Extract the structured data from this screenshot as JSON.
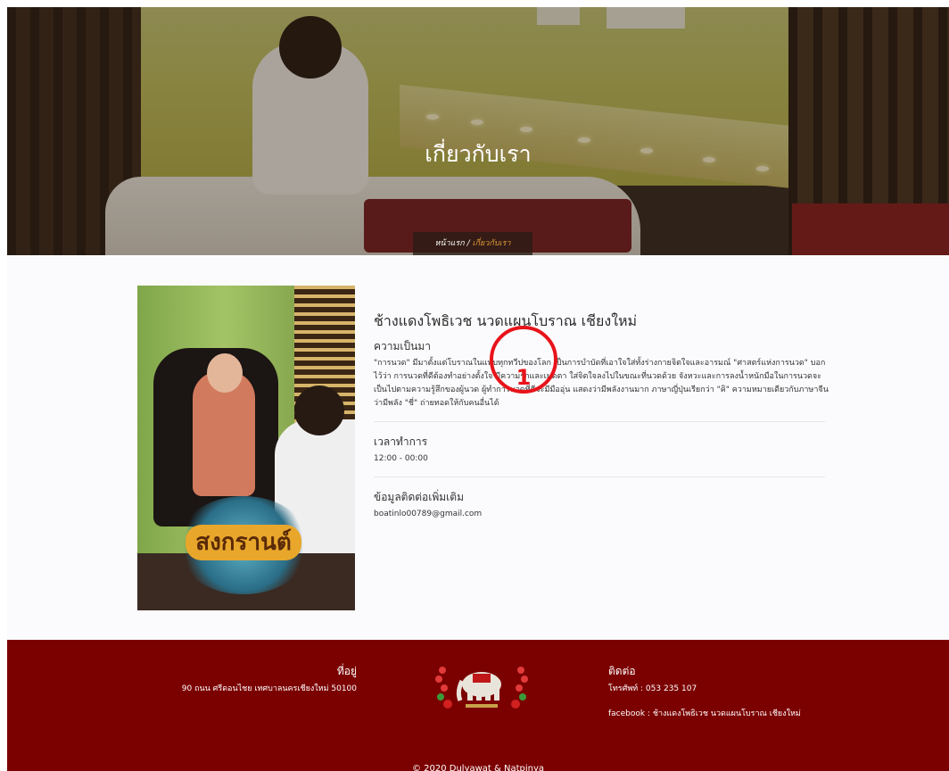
{
  "hero": {
    "title": "เกี่ยวกับเรา",
    "breadcrumb": {
      "home": "หน้าแรก",
      "separator": "/",
      "current": "เกี่ยวกับเรา"
    }
  },
  "about": {
    "shop_name": "ช้างแดงโพธิเวช นวดแผนโบราณ เชียงใหม่",
    "history": {
      "heading": "ความเป็นมา",
      "text": "\"การนวด\" มีมาตั้งแต่โบราณในแทบทุกทวีปของโลก เป็นการบำบัดที่เอาใจใส่ทั้งร่างกายจิตใจและอารมณ์ \"ศาสตร์แห่งการนวด\" บอกไว้ว่า การนวดที่ดีต้องทำอย่างตั้งใจ มีความรักและเมตตา ใส่จิตใจลงไปในขณะที่นวดด้วย จังหวะและการลงน้ำหนักมือในการนวดจะเป็นไปตามความรู้สึกของผู้นวด ผู้ทำการนวดที่ดีจะมีมืออุ่น แสดงว่ามีพลังงานมาก ภาษาญี่ปุ่นเรียกว่า \"คิ\" ความหมายเดียวกับภาษาจีนว่ามีพลัง \"ชี่\" ถ่ายทอดให้กับคนอื่นได้"
    },
    "hours": {
      "heading": "เวลาทำการ",
      "value": "12:00 - 00:00"
    },
    "contact": {
      "heading": "ข้อมูลติดต่อเพิ่มเติม",
      "email": "boatinlo00789@gmail.com"
    },
    "photo_badge": "สงกรานต์"
  },
  "annotation": {
    "number": "1",
    "color": "#e8131a"
  },
  "footer": {
    "address": {
      "heading": "ที่อยู่",
      "text": "90 ถนน ศรีดอนไชย เทศบาลนครเชียงใหม่ 50100"
    },
    "contact": {
      "heading": "ติดต่อ",
      "phone": "โทรศัพท์ : 053 235 107",
      "facebook": "facebook : ช้างแดงโพธิเวช นวดแผนโบราณ เชียงใหม่"
    },
    "copyright": "© 2020 Dulyawat & Natpinya",
    "bg_color": "#7b0000"
  },
  "colors": {
    "accent": "#e29b3a",
    "footer": "#7b0000",
    "marker": "#e8131a"
  }
}
